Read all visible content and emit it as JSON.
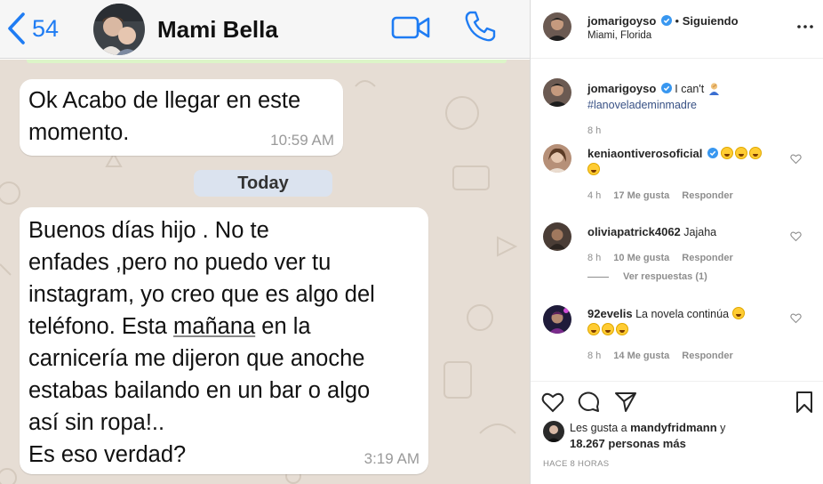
{
  "whatsapp": {
    "back_count": "54",
    "contact_name": "Mami Bella",
    "day_separator": "Today",
    "messages": [
      {
        "text": "Ok Acabo de llegar en este\nmomento.",
        "time": "10:59 AM"
      },
      {
        "text_before": "Buenos días hijo . No te\nenfades ,pero no puedo ver tu\ninstagram, yo creo que es algo del\nteléfono. Esta ",
        "underlined": "mañana",
        "text_after": " en la\ncarnicería me dijeron que anoche\nestabas bailando en un bar o algo\nasí sin ropa!..\nEs eso verdad?",
        "time": "3:19 AM"
      }
    ],
    "colors": {
      "accent": "#1f7cf3",
      "chat_background": "#e6ddd4",
      "bubble": "#ffffff"
    }
  },
  "instagram": {
    "header": {
      "username": "jomarigoyso",
      "separator": "•",
      "follow_status": "Siguiendo",
      "location": "Miami, Florida"
    },
    "caption": {
      "username": "jomarigoyso",
      "text": "I can't",
      "emoji": "person-facepalming",
      "hashtag": "#lanovelademinmadre",
      "time": "8 h"
    },
    "comments": [
      {
        "username": "keniaontiverosoficial",
        "verified": true,
        "text": "",
        "emoji": [
          "rolling-laughing",
          "rolling-laughing",
          "rolling-laughing",
          "rolling-laughing"
        ],
        "time": "4 h",
        "likes": "17 Me gusta",
        "reply": "Responder"
      },
      {
        "username": "oliviapatrick4062",
        "verified": false,
        "text": "Jajaha",
        "time": "8 h",
        "likes": "10 Me gusta",
        "reply": "Responder",
        "view_replies": "Ver respuestas (1)"
      },
      {
        "username": "92evelis",
        "verified": false,
        "text": "La novela continúa",
        "emoji": [
          "grinning-squinting",
          "grinning-squinting",
          "grinning-squinting",
          "smiling"
        ],
        "time": "8 h",
        "likes": "14 Me gusta",
        "reply": "Responder"
      }
    ],
    "likes": {
      "prefix": "Les gusta a",
      "user": "mandyfridmann",
      "and": "y",
      "count_text": "18.267 personas más"
    },
    "posted_ago": "HACE 8 HORAS",
    "icons": [
      "heart-icon",
      "comment-icon",
      "share-icon",
      "bookmark-icon",
      "more-icon",
      "verified-icon"
    ],
    "colors": {
      "verified": "#3897f0",
      "link": "#385185",
      "muted": "#8e8e8e"
    }
  }
}
